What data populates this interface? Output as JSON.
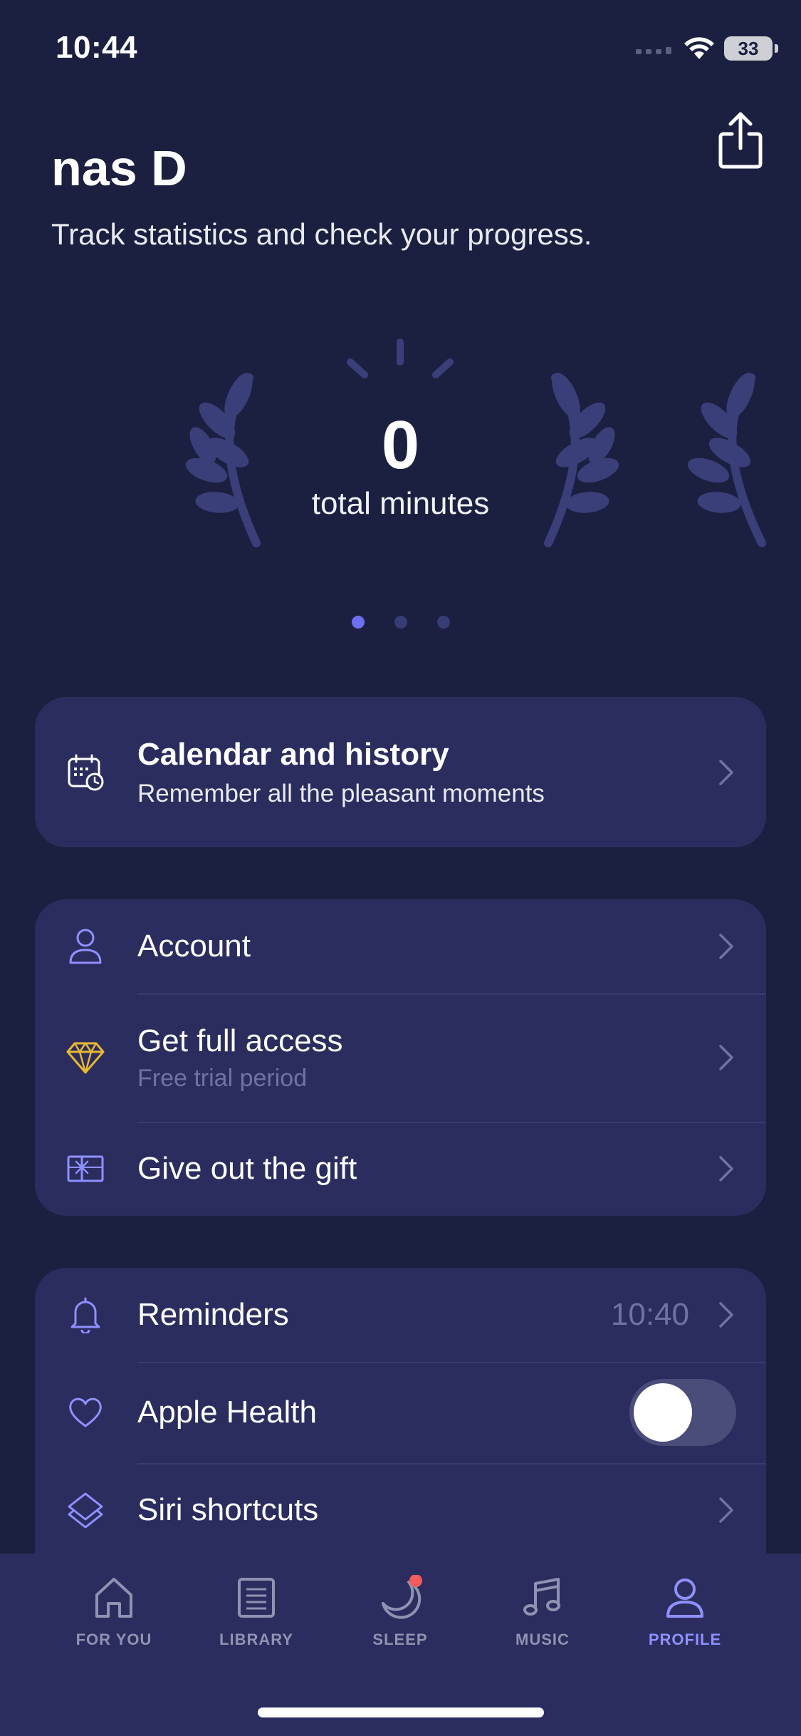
{
  "status_bar": {
    "time": "10:44",
    "battery": "33"
  },
  "header": {
    "name": "nas D",
    "subtitle": "Track statistics and check your progress."
  },
  "stats": {
    "value": "0",
    "label": "total minutes",
    "pages": 3,
    "active_page": 1
  },
  "calendar_card": {
    "title": "Calendar and history",
    "subtitle": "Remember all the pleasant moments"
  },
  "account_card": {
    "items": [
      {
        "label": "Account",
        "icon": "person-icon"
      },
      {
        "label": "Get full access",
        "sublabel": "Free trial period",
        "icon": "diamond-icon"
      },
      {
        "label": "Give out the gift",
        "icon": "gift-icon"
      }
    ]
  },
  "settings_card": {
    "items": [
      {
        "label": "Reminders",
        "value": "10:40",
        "icon": "bell-icon"
      },
      {
        "label": "Apple Health",
        "toggle": false,
        "icon": "heart-icon"
      },
      {
        "label": "Siri shortcuts",
        "icon": "layers-icon"
      }
    ]
  },
  "tab_bar": {
    "tabs": [
      {
        "label": "FOR YOU",
        "icon": "home-icon"
      },
      {
        "label": "LIBRARY",
        "icon": "book-icon"
      },
      {
        "label": "SLEEP",
        "icon": "moon-icon",
        "badge": true
      },
      {
        "label": "MUSIC",
        "icon": "music-icon"
      },
      {
        "label": "PROFILE",
        "icon": "profile-icon",
        "active": true
      }
    ]
  },
  "colors": {
    "background": "#1b2040",
    "card": "#2b2d5e",
    "accent": "#8f90ff",
    "muted_text": "#6f73a3",
    "gold": "#e8b830",
    "badge": "#f25c5c"
  }
}
